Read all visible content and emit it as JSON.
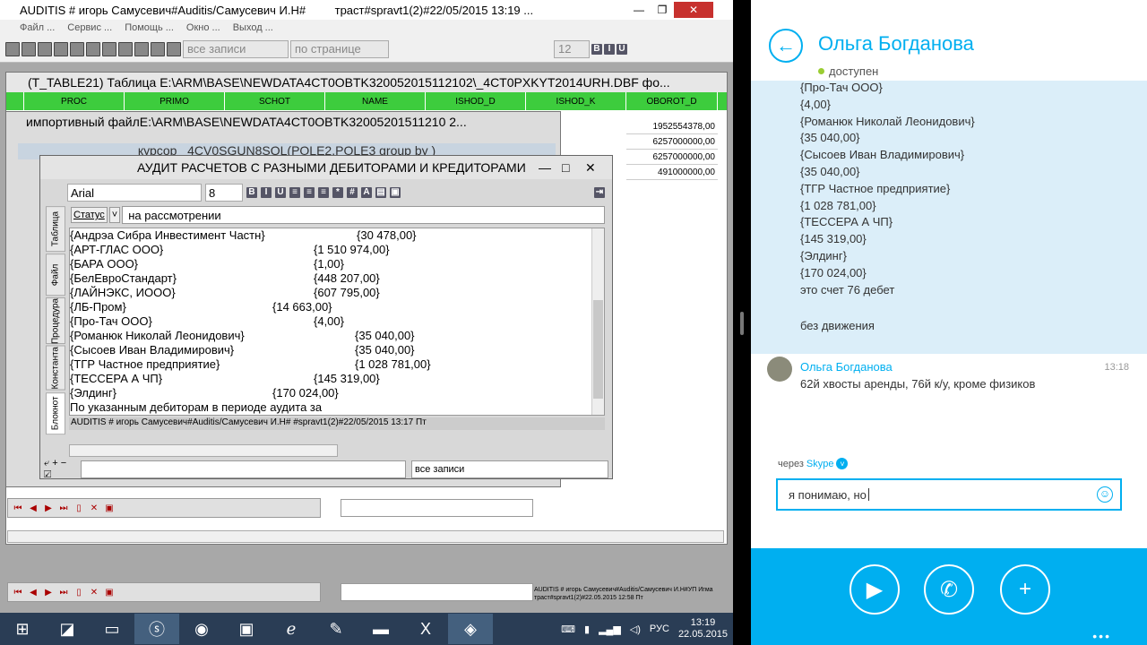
{
  "main_window": {
    "title": "AUDITIS # игорь Самусевич#Auditis/Самусевич И.Н#",
    "title_tail": "траст#spravt1(2)#22/05/2015 13:19 ...",
    "menu": [
      "Файл ...",
      "Сервис ...",
      "Помощь ...",
      "Окно ...",
      "Выход ..."
    ],
    "toolbar": {
      "records_select": "все записи",
      "per_page_select": "по странице",
      "font_size": "12"
    }
  },
  "table_window": {
    "title": "(T_TABLE21)  Таблица E:\\ARM\\BASE\\NEWDATA4CT0OBTK320052015112102\\_4CT0PXKYT2014URH.DBF фо...",
    "columns": [
      "PROC",
      "PRIMO",
      "SCHOT",
      "NAME",
      "ISHOD_D",
      "ISHOD_K",
      "OBOROT_D"
    ],
    "oborot_values": [
      "1952554378,00",
      "6257000000,00",
      "6257000000,00",
      "491000000,00"
    ]
  },
  "import_window": {
    "title": "импортивный файлE:\\ARM\\BASE\\NEWDATA4CT0OBTK32005201511210 2...",
    "cursor_text": "курсор _4CV0SGUN8SQL(POLE2,POLE3 group by )"
  },
  "audit_window": {
    "title": "АУДИТ РАСЧЕТОВ   С РАЗНЫМИ ДЕБИТОРАМИ И КРЕДИТОРАМИ",
    "font_name": "Arial",
    "font_size": "8",
    "status_label": "Статус",
    "status_value": "на рассмотрении",
    "side_tabs": [
      "Таблица",
      "Файл",
      "Процедура",
      "Константа",
      "Блокнот"
    ],
    "lines": [
      {
        "name": "{Андрэа Сибра Инвестимент Частн}",
        "amount": "{30 478,00}",
        "offset": 320
      },
      {
        "name": "{АРТ-ГЛАС ООО}",
        "amount": "{1 510 974,00}",
        "offset": 272
      },
      {
        "name": "{БАРА ООО}",
        "amount": "{1,00}",
        "offset": 272
      },
      {
        "name": "{БелЕвроСтандарт}",
        "amount": "{448 207,00}",
        "offset": 272
      },
      {
        "name": "{ЛАЙНЭКС, ИООО}",
        "amount": "{607 795,00}",
        "offset": 272
      },
      {
        "name": "{ЛБ-Пром}",
        "amount": "{14 663,00}",
        "offset": 226
      },
      {
        "name": "{Про-Тач ООО}",
        "amount": "{4,00}",
        "offset": 272
      },
      {
        "name": "{Романюк Николай Леонидович}",
        "amount": "{35 040,00}",
        "offset": 318
      },
      {
        "name": "{Сысоев Иван Владимирович}",
        "amount": "{35 040,00}",
        "offset": 318
      },
      {
        "name": "{ТГР Частное предприятие}",
        "amount": "{1 028 781,00}",
        "offset": 318
      },
      {
        "name": "{ТЕССЕРА А ЧП}",
        "amount": "{145 319,00}",
        "offset": 272
      },
      {
        "name": "{Элдинг}",
        "amount": "{170 024,00}",
        "offset": 226
      }
    ],
    "last_line": "По указанным дебиторам в периоде аудита за",
    "statusbar": "AUDITIS # игорь Самусевич#Auditis/Самусевич И.Н#              #spravt1(2)#22/05/2015 13:17 Пт",
    "bottom_select": "все записи"
  },
  "bottom_status": "AUDITIS # игорь Самусевич#Auditis/Самусевич И.Н#УП Игма траст#spravt1(2)#22.05.2015 12:58 Пт",
  "taskbar": {
    "lang": "РУС",
    "time": "13:19",
    "date": "22.05.2015"
  },
  "skype": {
    "contact_name": "Ольга Богданова",
    "presence": "доступен",
    "messages": [
      "{Про-Тач ООО}",
      "{4,00}",
      "{Романюк Николай Леонидович}",
      "{35 040,00}",
      "{Сысоев Иван Владимирович}",
      "{35 040,00}",
      "{ТГР Частное предприятие}",
      "{1 028 781,00}",
      "{ТЕССЕРА А ЧП}",
      "{145 319,00}",
      "{Элдинг}",
      "{170 024,00}",
      "это счет 76 дебет"
    ],
    "extra_message": "без движения",
    "reply_name": "Ольга Богданова",
    "reply_time": "13:18",
    "reply_text": "62й хвосты аренды, 76й к/у, кроме физиков",
    "via_label": "через",
    "via_service": "Skype",
    "input_value": "я понимаю, но"
  }
}
